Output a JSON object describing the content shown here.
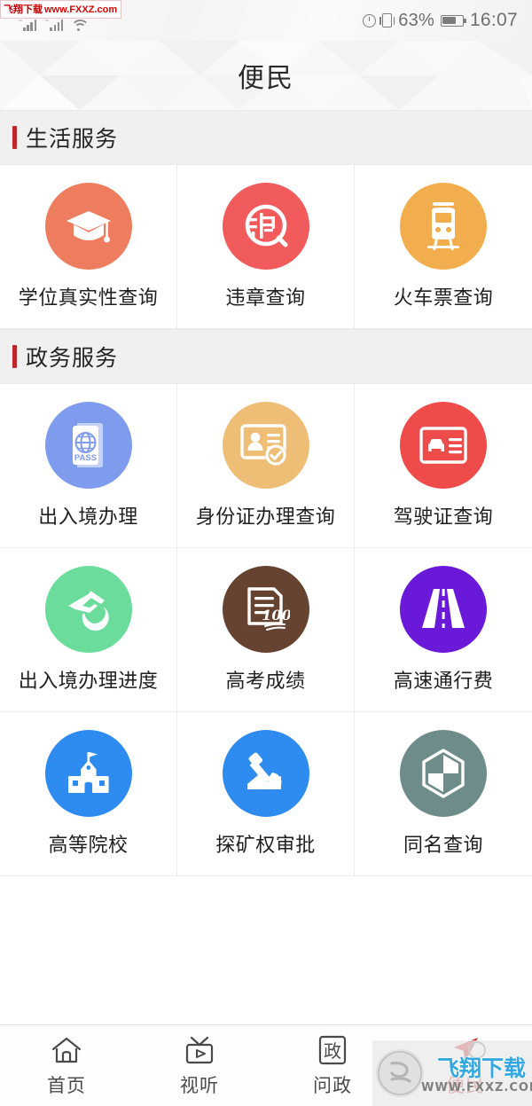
{
  "statusbar": {
    "signal_1_icon": "signal-bars-icon",
    "signal_2_icon": "signal-bars-icon",
    "wifi_icon": "wifi-icon",
    "alarm_icon": "alarm-clock-icon",
    "vibrate_icon": "vibrate-icon",
    "battery_percent": "63%",
    "battery_icon": "battery-icon",
    "time": "16:07"
  },
  "watermark": {
    "top_cn": "飞翔下载",
    "top_url": "www.FXXZ.com",
    "bottom_cn": "飞翔下载",
    "bottom_url": "WWW.FXXZ.COM"
  },
  "header": {
    "title": "便民"
  },
  "colors": {
    "accent_red": "#c0272d",
    "section_bg": "#f0f0f0"
  },
  "sections": [
    {
      "title": "生活服务",
      "items": [
        {
          "label": "学位真实性查询",
          "icon": "graduation-cap-icon",
          "color": "#ED7D5E"
        },
        {
          "label": "违章查询",
          "icon": "violation-search-icon",
          "color": "#F15B5B"
        },
        {
          "label": "火车票查询",
          "icon": "train-icon",
          "color": "#F2AE4E"
        }
      ]
    },
    {
      "title": "政务服务",
      "items": [
        {
          "label": "出入境办理",
          "icon": "passport-icon",
          "color": "#7E9BEE"
        },
        {
          "label": "身份证办理查询",
          "icon": "id-card-check-icon",
          "color": "#EEBE76"
        },
        {
          "label": "驾驶证查询",
          "icon": "drivers-license-icon",
          "color": "#EE4B4B"
        },
        {
          "label": "出入境办理进度",
          "icon": "plane-globe-icon",
          "color": "#6BDC9B"
        },
        {
          "label": "高考成绩",
          "icon": "score-document-icon",
          "color": "#664330"
        },
        {
          "label": "高速通行费",
          "icon": "highway-icon",
          "color": "#6A19D8"
        },
        {
          "label": "高等院校",
          "icon": "school-building-icon",
          "color": "#2E8BEF"
        },
        {
          "label": "探矿权审批",
          "icon": "mining-shovel-icon",
          "color": "#2E8BEF"
        },
        {
          "label": "同名查询",
          "icon": "hexagon-shield-icon",
          "color": "#6E8C8A"
        }
      ]
    }
  ],
  "tabbar": [
    {
      "label": "首页",
      "icon": "home-icon",
      "active": false
    },
    {
      "label": "视听",
      "icon": "tv-play-icon",
      "active": false
    },
    {
      "label": "问政",
      "icon": "government-box-icon",
      "active": false
    },
    {
      "label": "便民",
      "icon": "paper-plane-icon",
      "active": true
    }
  ]
}
